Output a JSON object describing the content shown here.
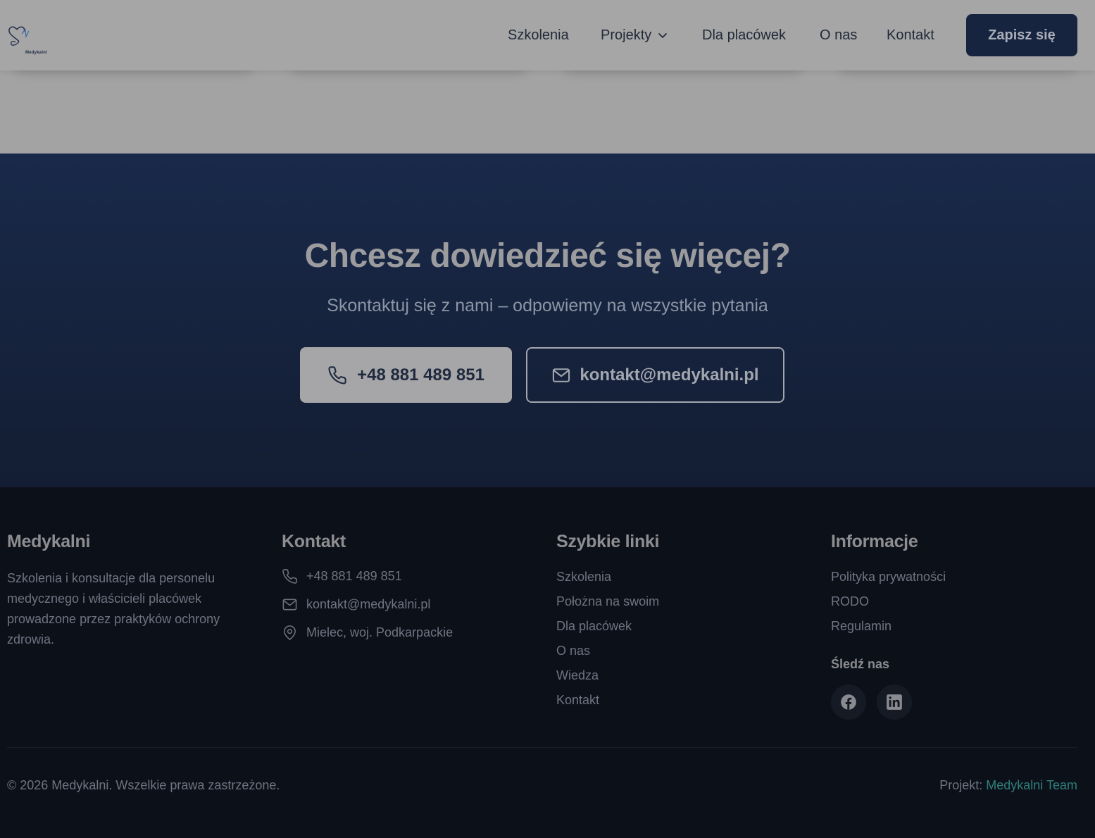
{
  "header": {
    "logo_text": "Medykalni",
    "nav": [
      {
        "label": "Szkolenia"
      },
      {
        "label": "Projekty"
      },
      {
        "label": "Dla placówek"
      },
      {
        "label": "O nas"
      },
      {
        "label": "Kontakt"
      }
    ],
    "cta_label": "Zapisz się"
  },
  "cta": {
    "title": "Chcesz dowiedzieć się więcej?",
    "subtitle": "Skontaktuj się z nami – odpowiemy na wszystkie pytania",
    "phone_label": "+48 881 489 851",
    "email_label": "kontakt@medykalni.pl"
  },
  "footer": {
    "about": {
      "title": "Medykalni",
      "text": "Szkolenia i konsultacje dla personelu medycznego i właścicieli placówek prowadzone przez praktyków ochrony zdrowia."
    },
    "contact": {
      "title": "Kontakt",
      "phone": "+48 881 489 851",
      "email": "kontakt@medykalni.pl",
      "address": "Mielec, woj. Podkarpackie"
    },
    "quick_links": {
      "title": "Szybkie linki",
      "items": [
        "Szkolenia",
        "Położna na swoim",
        "Dla placówek",
        "O nas",
        "Wiedza",
        "Kontakt"
      ]
    },
    "info": {
      "title": "Informacje",
      "items": [
        "Polityka prywatności",
        "RODO",
        "Regulamin"
      ],
      "follow_title": "Śledź nas"
    },
    "copyright": "© 2026 Medykalni. Wszelkie prawa zastrzeżone.",
    "credit_prefix": "Projekt: ",
    "credit_link": "Medykalni Team"
  },
  "icons": {
    "phone": "phone-icon",
    "mail": "mail-icon",
    "location": "map-pin-icon",
    "facebook": "facebook-icon",
    "linkedin": "linkedin-icon",
    "chevron": "chevron-down-icon"
  },
  "colors": {
    "navy": "#172440",
    "footer_bg": "#0c1019",
    "accent_teal": "#2f7f7d"
  }
}
